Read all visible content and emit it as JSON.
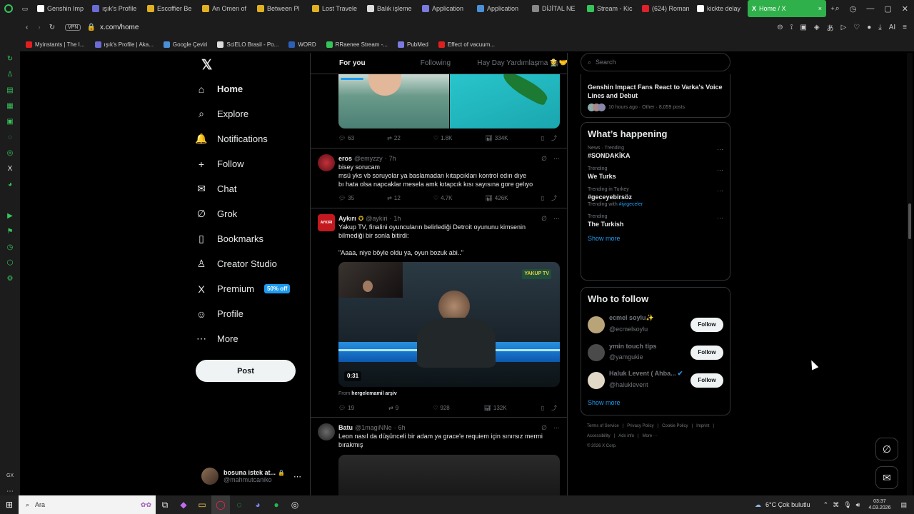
{
  "browser": {
    "tabs": [
      {
        "label": "Genshin Imp",
        "color": "#ffffff"
      },
      {
        "label": "ışık's Profile",
        "color": "#6b6bd6"
      },
      {
        "label": "Escoffier Be",
        "color": "#e0b020"
      },
      {
        "label": "An Omen of",
        "color": "#e0b020"
      },
      {
        "label": "Between Pl",
        "color": "#e0b020"
      },
      {
        "label": "Lost Travele",
        "color": "#e0b020"
      },
      {
        "label": "Balık işleme",
        "color": "#dddddd"
      },
      {
        "label": "Application",
        "color": "#7a7ae0"
      },
      {
        "label": "Application",
        "color": "#4a90d9"
      },
      {
        "label": "DİJİTAL NE",
        "color": "#888888"
      },
      {
        "label": "Stream - Kic",
        "color": "#35c45a"
      },
      {
        "label": "(624) Roman",
        "color": "#e0202a"
      },
      {
        "label": "kickte delay",
        "color": "#ffffff"
      }
    ],
    "active_tab": "Home / X",
    "url": "x.com/home",
    "vpn": "VPN",
    "ai_label": "AI",
    "bookmarks": [
      {
        "label": "Myinstants | The I...",
        "color": "#e02020"
      },
      {
        "label": "ışık's Profile | Aka...",
        "color": "#6b6bd6"
      },
      {
        "label": "Google Çeviri",
        "color": "#4a90d9"
      },
      {
        "label": "SciELO Brasil - Po...",
        "color": "#dddddd"
      },
      {
        "label": "WORD",
        "color": "#2b5fb8"
      },
      {
        "label": "RRaenee Stream -...",
        "color": "#35c45a"
      },
      {
        "label": "PubMed",
        "color": "#7a7ae0"
      },
      {
        "label": "Effect of vacuum...",
        "color": "#e02020"
      }
    ]
  },
  "nav": {
    "items": [
      {
        "label": "Home",
        "icon": "⌂",
        "bold": true
      },
      {
        "label": "Explore",
        "icon": "⌕"
      },
      {
        "label": "Notifications",
        "icon": "🔔"
      },
      {
        "label": "Follow",
        "icon": "+"
      },
      {
        "label": "Chat",
        "icon": "✉"
      },
      {
        "label": "Grok",
        "icon": "∅"
      },
      {
        "label": "Bookmarks",
        "icon": "▯"
      },
      {
        "label": "Creator Studio",
        "icon": "♙"
      },
      {
        "label": "Premium",
        "icon": "X",
        "badge": "50% off"
      },
      {
        "label": "Profile",
        "icon": "☺"
      },
      {
        "label": "More",
        "icon": "⋯"
      }
    ],
    "post": "Post",
    "account": {
      "name": "bosuna istek at...",
      "handle": "@mahmutcaniko"
    }
  },
  "feed": {
    "tabs": [
      "For you",
      "Following",
      "Hay Day Yardımlaşma 👩‍🌾🤝"
    ],
    "tweets": [
      {
        "stats": {
          "replies": "63",
          "retweets": "22",
          "likes": "1.8K",
          "views": "334K"
        }
      },
      {
        "name": "eros",
        "handle": "@emyzzy",
        "time": "7h",
        "lines": [
          "bisey sorucam",
          "msü yks vb soruyolar ya baslamadan kıtapcıkları kontrol edın dıye",
          "bı hata olsa napcaklar mesela amk kıtapcık kısı sayısına gore gelıyo"
        ],
        "stats": {
          "replies": "35",
          "retweets": "12",
          "likes": "4.7K",
          "views": "426K"
        }
      },
      {
        "name": "Aykırı",
        "handle": "@aykiri",
        "time": "1h",
        "avatar_text": "AYKIRI",
        "lines": [
          "Yakup TV, finalini oyuncuların belirlediği Detroit oyununu kimsenin",
          "bilmediği bir sonla bitirdi:",
          "",
          "\"Aaaa, niye böyle oldu ya, oyun bozuk abi..\""
        ],
        "video_time": "0:31",
        "video_watermark": "YAKUP TV",
        "from_label": "From",
        "from_source": "hergelemamil arşiv",
        "stats": {
          "replies": "19",
          "retweets": "9",
          "likes": "928",
          "views": "132K"
        }
      },
      {
        "name": "Batu",
        "handle": "@1magiNNe",
        "time": "6h",
        "lines": [
          "Leon nasıl da düşünceli bir adam ya grace'e requiem için sınırsız mermi",
          "bırakmış"
        ]
      }
    ]
  },
  "sidebar": {
    "search_placeholder": "Search",
    "news": {
      "title": "Genshin Impact Fans React to Varka's Voice Lines and Debut",
      "meta": "10 hours ago · Other · 8,059 posts"
    },
    "happening_title": "What’s happening",
    "trends": [
      {
        "meta": "News · Trending",
        "name": "#SONDAKİKA"
      },
      {
        "meta": "Trending",
        "name": "We Turks"
      },
      {
        "meta": "Trending in Turkey",
        "name": "#geceyebirsöz",
        "with_label": "Trending with",
        "with_tag": "#iyigeceler"
      },
      {
        "meta": "Trending",
        "name": "The Turkish"
      }
    ],
    "show_more": "Show more",
    "wtf_title": "Who to follow",
    "wtf": [
      {
        "name": "ecmel soylu✨",
        "handle": "@ecmelsoylu"
      },
      {
        "name": "ymin touch tips",
        "handle": "@yamgukie"
      },
      {
        "name": "Haluk Levent ( Ahba...",
        "handle": "@haluklevent",
        "verified": true
      }
    ],
    "follow": "Follow",
    "footer": [
      "Terms of Service",
      "|",
      "Privacy Policy",
      "|",
      "Cookie Policy",
      "|",
      "Imprint",
      "|",
      "Accessibility",
      "|",
      "Ads info",
      "|",
      "More ···",
      "© 2026 X Corp."
    ]
  },
  "taskbar": {
    "search": "Ara",
    "weather": "6°C  Çok bulutlu",
    "time": "03:37",
    "date": "4.03.2026"
  },
  "colors": {
    "accent": "#1d9bf0",
    "opera_green": "#35c45a",
    "active_tab": "#2fb04a"
  }
}
